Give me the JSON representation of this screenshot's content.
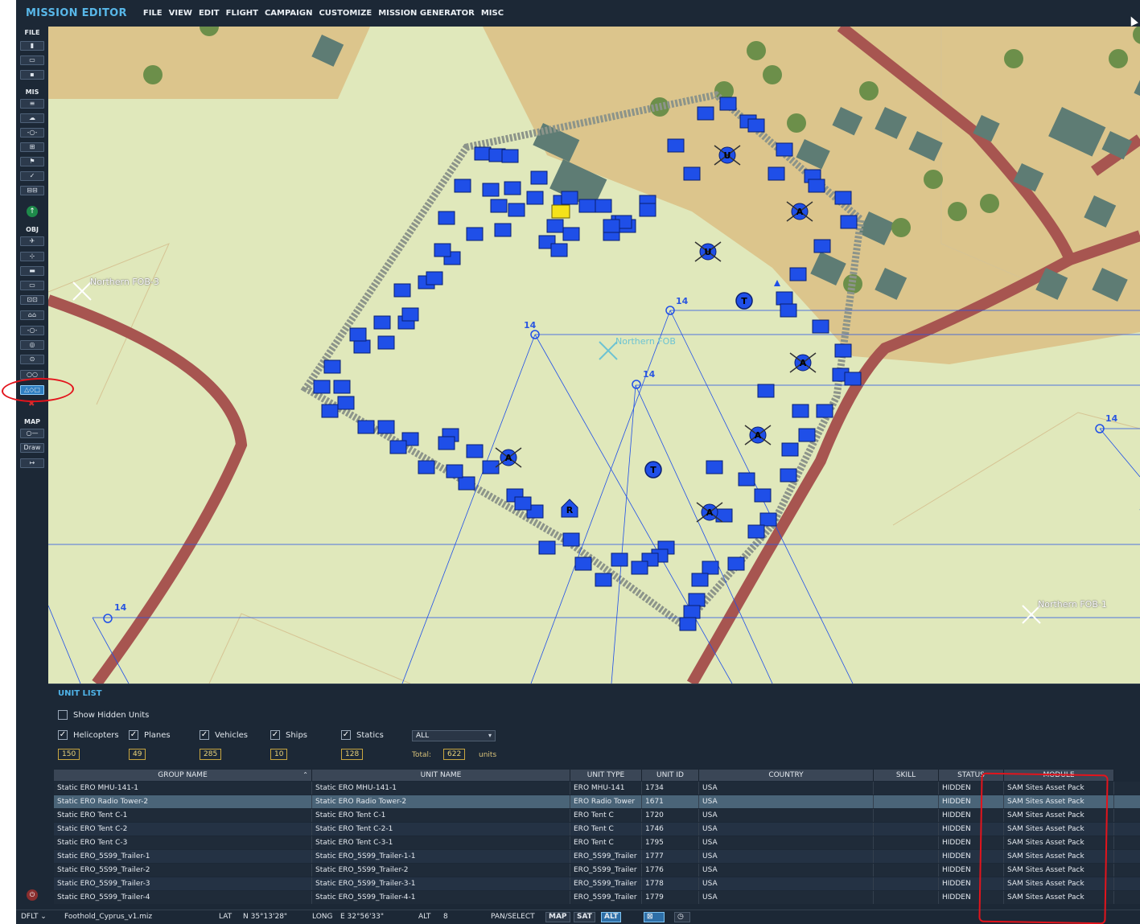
{
  "app_title": "MISSION EDITOR",
  "menu": [
    "FILE",
    "VIEW",
    "EDIT",
    "FLIGHT",
    "CAMPAIGN",
    "CUSTOMIZE",
    "MISSION GENERATOR",
    "MISC"
  ],
  "toolbar": {
    "sections": [
      "FILE",
      "MIS",
      "OBJ",
      "MAP"
    ],
    "draw_label": "Draw"
  },
  "map": {
    "labels": {
      "fob3": "Northern FOB-3",
      "fob": "Northern FOB",
      "fob1": "Northern FOB-1"
    },
    "waypoint_label": "14",
    "structure_letters": {
      "t": "T",
      "r": "R",
      "u": "U",
      "a": "A"
    }
  },
  "unit_list": {
    "title": "UNIT LIST",
    "show_hidden_label": "Show Hidden Units",
    "categories": [
      {
        "label": "Helicopters",
        "count": "150"
      },
      {
        "label": "Planes",
        "count": "49"
      },
      {
        "label": "Vehicles",
        "count": "285"
      },
      {
        "label": "Ships",
        "count": "10"
      },
      {
        "label": "Statics",
        "count": "128"
      }
    ],
    "filter_value": "ALL",
    "total_label": "Total:",
    "total_value": "622",
    "units_label": "units",
    "columns": [
      "GROUP NAME",
      "UNIT NAME",
      "UNIT TYPE",
      "UNIT ID",
      "COUNTRY",
      "SKILL",
      "STATUS",
      "MODULE"
    ],
    "rows": [
      [
        "Static ERO MHU-141-1",
        "Static ERO MHU-141-1",
        "ERO MHU-141",
        "1734",
        "USA",
        "",
        "HIDDEN",
        "SAM Sites Asset Pack"
      ],
      [
        "Static ERO Radio Tower-2",
        "Static ERO Radio Tower-2",
        "ERO Radio Tower",
        "1671",
        "USA",
        "",
        "HIDDEN",
        "SAM Sites Asset Pack"
      ],
      [
        "Static ERO Tent C-1",
        "Static ERO Tent C-1",
        "ERO Tent C",
        "1720",
        "USA",
        "",
        "HIDDEN",
        "SAM Sites Asset Pack"
      ],
      [
        "Static ERO Tent C-2",
        "Static ERO Tent C-2-1",
        "ERO Tent C",
        "1746",
        "USA",
        "",
        "HIDDEN",
        "SAM Sites Asset Pack"
      ],
      [
        "Static ERO Tent C-3",
        "Static ERO Tent C-3-1",
        "ERO Tent C",
        "1795",
        "USA",
        "",
        "HIDDEN",
        "SAM Sites Asset Pack"
      ],
      [
        "Static ERO_5S99_Trailer-1",
        "Static ERO_5S99_Trailer-1-1",
        "ERO_5S99_Trailer",
        "1777",
        "USA",
        "",
        "HIDDEN",
        "SAM Sites Asset Pack"
      ],
      [
        "Static ERO_5S99_Trailer-2",
        "Static ERO_5S99_Trailer-2",
        "ERO_5S99_Trailer",
        "1776",
        "USA",
        "",
        "HIDDEN",
        "SAM Sites Asset Pack"
      ],
      [
        "Static ERO_5S99_Trailer-3",
        "Static ERO_5S99_Trailer-3-1",
        "ERO_5S99_Trailer",
        "1778",
        "USA",
        "",
        "HIDDEN",
        "SAM Sites Asset Pack"
      ],
      [
        "Static ERO_5S99_Trailer-4",
        "Static ERO_5S99_Trailer-4-1",
        "ERO_5S99_Trailer",
        "1779",
        "USA",
        "",
        "HIDDEN",
        "SAM Sites Asset Pack"
      ]
    ],
    "selected_row": 1
  },
  "statusbar": {
    "profile": "DFLT",
    "filename": "Foothold_Cyprus_v1.miz",
    "lat_label": "LAT",
    "lat_value": "N 35°13'28\"",
    "long_label": "LONG",
    "long_value": "E 32°56'33\"",
    "alt_label": "ALT",
    "alt_value": "8",
    "mode": "PAN/SELECT",
    "map_btn": "MAP",
    "sat_btn": "SAT",
    "alt_btn": "ALT"
  },
  "colors": {
    "unit_blue": "#1f4fe8",
    "terrain_green": "#e0e8bb",
    "terrain_sand": "#dcc58c",
    "road": "#a75550",
    "accent": "#4fb3e8",
    "annotation_red": "#e3141c"
  }
}
